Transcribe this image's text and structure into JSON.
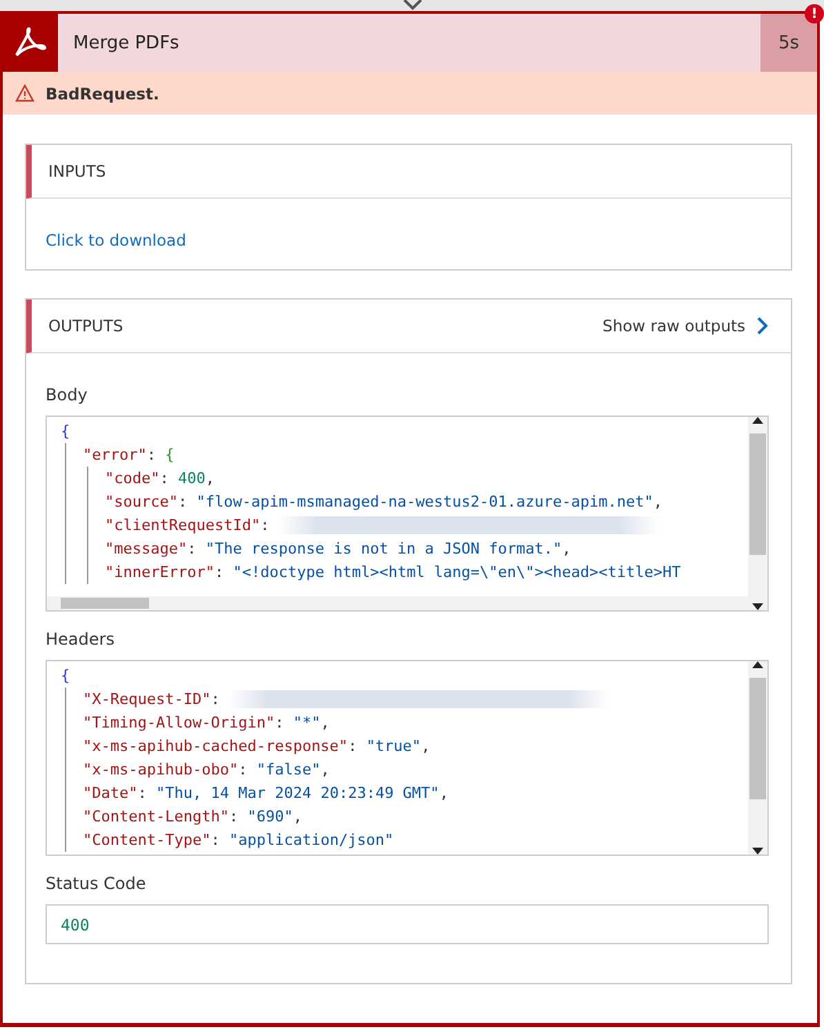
{
  "action": {
    "title": "Merge PDFs",
    "duration": "5s",
    "alert_badge": "!"
  },
  "error_bar": {
    "message": "BadRequest."
  },
  "inputs": {
    "title": "INPUTS",
    "link": "Click to download"
  },
  "outputs": {
    "title": "OUTPUTS",
    "raw_button": "Show raw outputs",
    "body": {
      "label": "Body",
      "code": {
        "open": "{",
        "children": [
          {
            "tokens": [
              {
                "kind": "key",
                "text": "\"error\""
              },
              {
                "kind": "punct",
                "text": ": "
              },
              {
                "kind": "brace",
                "text": "{"
              }
            ],
            "children": [
              {
                "tokens": [
                  {
                    "kind": "key",
                    "text": "\"code\""
                  },
                  {
                    "kind": "punct",
                    "text": ": "
                  },
                  {
                    "kind": "number",
                    "text": "400"
                  },
                  {
                    "kind": "punct",
                    "text": ","
                  }
                ]
              },
              {
                "tokens": [
                  {
                    "kind": "key",
                    "text": "\"source\""
                  },
                  {
                    "kind": "punct",
                    "text": ": "
                  },
                  {
                    "kind": "string",
                    "text": "\"flow-apim-msmanaged-na-westus2-01.azure-apim.net\""
                  },
                  {
                    "kind": "punct",
                    "text": ","
                  }
                ]
              },
              {
                "tokens": [
                  {
                    "kind": "key",
                    "text": "\"clientRequestId\""
                  },
                  {
                    "kind": "punct",
                    "text": ": "
                  },
                  {
                    "kind": "redacted"
                  }
                ]
              },
              {
                "tokens": [
                  {
                    "kind": "key",
                    "text": "\"message\""
                  },
                  {
                    "kind": "punct",
                    "text": ": "
                  },
                  {
                    "kind": "string",
                    "text": "\"The response is not in a JSON format.\""
                  },
                  {
                    "kind": "punct",
                    "text": ","
                  }
                ]
              },
              {
                "tokens": [
                  {
                    "kind": "key",
                    "text": "\"innerError\""
                  },
                  {
                    "kind": "punct",
                    "text": ": "
                  },
                  {
                    "kind": "string",
                    "text": "\"<!doctype html><html lang=\\\"en\\\"><head><title>HT"
                  }
                ]
              }
            ]
          }
        ]
      }
    },
    "headers": {
      "label": "Headers",
      "code": {
        "open": "{",
        "children": [
          {
            "tokens": [
              {
                "kind": "key",
                "text": "\"X-Request-ID\""
              },
              {
                "kind": "punct",
                "text": ": "
              },
              {
                "kind": "redacted"
              }
            ]
          },
          {
            "tokens": [
              {
                "kind": "key",
                "text": "\"Timing-Allow-Origin\""
              },
              {
                "kind": "punct",
                "text": ": "
              },
              {
                "kind": "string",
                "text": "\"*\""
              },
              {
                "kind": "punct",
                "text": ","
              }
            ]
          },
          {
            "tokens": [
              {
                "kind": "key",
                "text": "\"x-ms-apihub-cached-response\""
              },
              {
                "kind": "punct",
                "text": ": "
              },
              {
                "kind": "string",
                "text": "\"true\""
              },
              {
                "kind": "punct",
                "text": ","
              }
            ]
          },
          {
            "tokens": [
              {
                "kind": "key",
                "text": "\"x-ms-apihub-obo\""
              },
              {
                "kind": "punct",
                "text": ": "
              },
              {
                "kind": "string",
                "text": "\"false\""
              },
              {
                "kind": "punct",
                "text": ","
              }
            ]
          },
          {
            "tokens": [
              {
                "kind": "key",
                "text": "\"Date\""
              },
              {
                "kind": "punct",
                "text": ": "
              },
              {
                "kind": "string",
                "text": "\"Thu, 14 Mar 2024 20:23:49 GMT\""
              },
              {
                "kind": "punct",
                "text": ","
              }
            ]
          },
          {
            "tokens": [
              {
                "kind": "key",
                "text": "\"Content-Length\""
              },
              {
                "kind": "punct",
                "text": ": "
              },
              {
                "kind": "string",
                "text": "\"690\""
              },
              {
                "kind": "punct",
                "text": ","
              }
            ]
          },
          {
            "tokens": [
              {
                "kind": "key",
                "text": "\"Content-Type\""
              },
              {
                "kind": "punct",
                "text": ": "
              },
              {
                "kind": "string",
                "text": "\"application/json\""
              }
            ]
          }
        ]
      }
    },
    "status_code": {
      "label": "Status Code",
      "value": "400"
    }
  }
}
